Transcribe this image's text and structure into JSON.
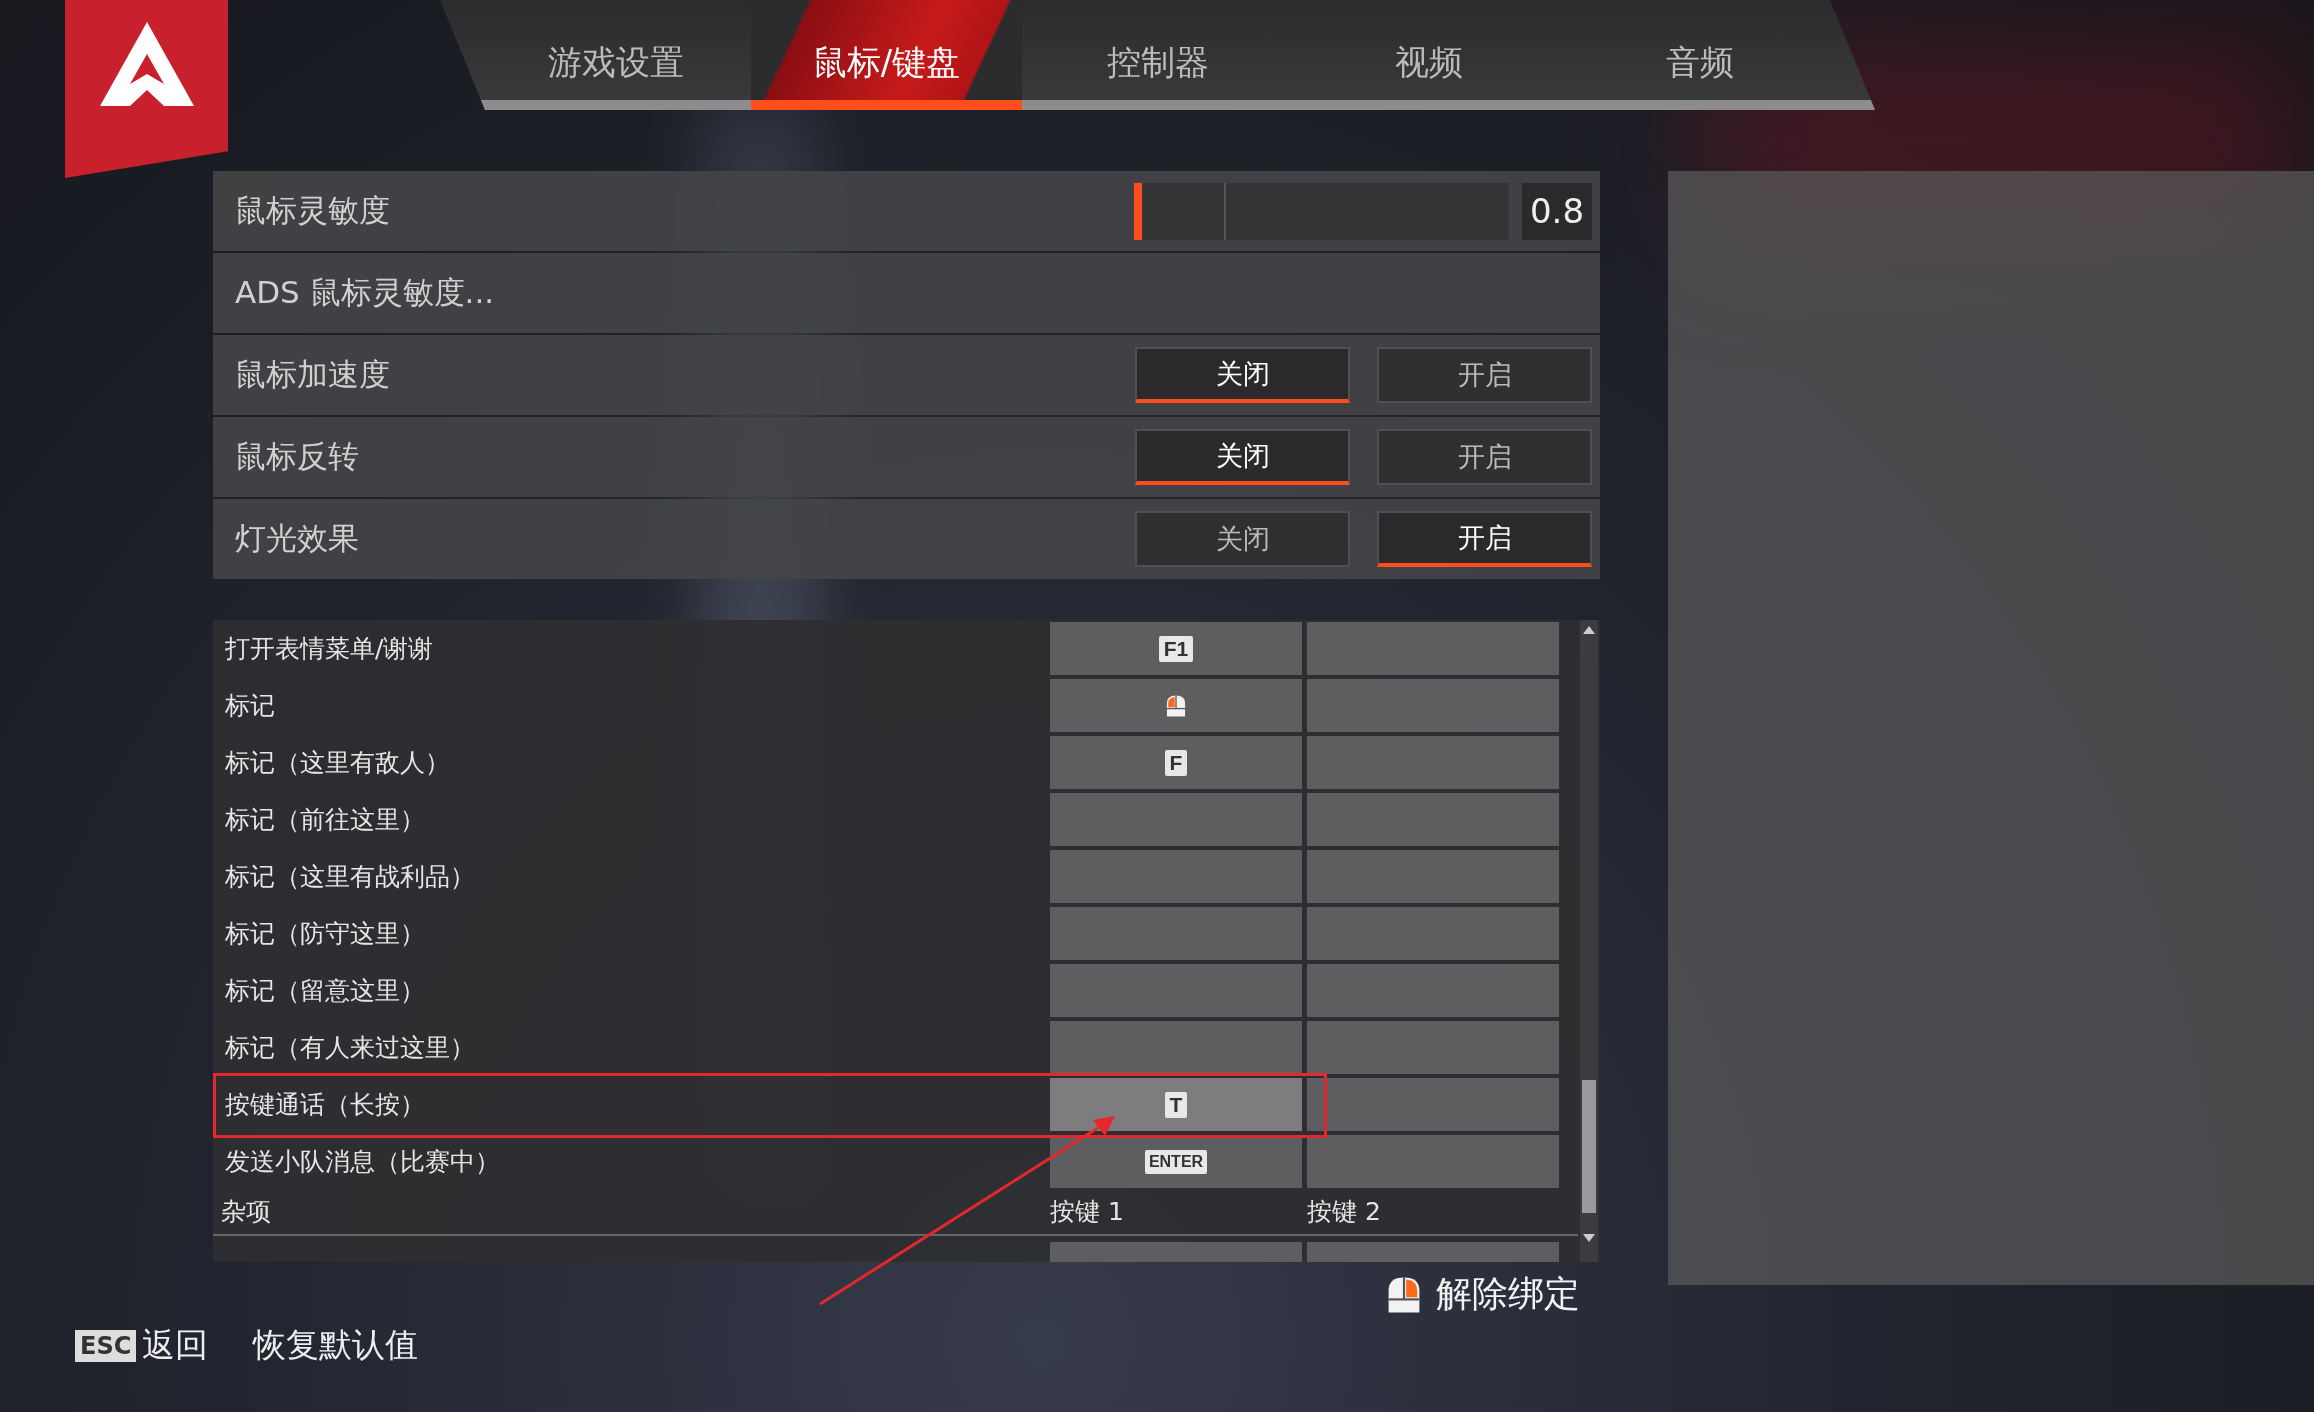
{
  "tabs": [
    {
      "label": "游戏设置",
      "selected": false
    },
    {
      "label": "鼠标/键盘",
      "selected": true
    },
    {
      "label": "控制器",
      "selected": false
    },
    {
      "label": "视频",
      "selected": false
    },
    {
      "label": "音频",
      "selected": false
    }
  ],
  "settings": [
    {
      "kind": "slider",
      "label": "鼠标灵敏度",
      "level": 0.02,
      "reading": "0.8"
    },
    {
      "kind": "link",
      "label": "ADS 鼠标灵敏度..."
    },
    {
      "kind": "toggle",
      "label": "鼠标加速度",
      "options": [
        {
          "label": "关闭",
          "selected": true
        },
        {
          "label": "开启",
          "selected": false
        }
      ]
    },
    {
      "kind": "toggle",
      "label": "鼠标反转",
      "options": [
        {
          "label": "关闭",
          "selected": true
        },
        {
          "label": "开启",
          "selected": false
        }
      ]
    },
    {
      "kind": "toggle",
      "label": "灯光效果",
      "options": [
        {
          "label": "关闭",
          "selected": false
        },
        {
          "label": "开启",
          "selected": true
        }
      ]
    }
  ],
  "bindings": [
    {
      "action": "打开表情菜单/谢谢",
      "selected": false,
      "keys": [
        {
          "kind": "key",
          "label": "F1"
        },
        {
          "kind": "empty"
        }
      ]
    },
    {
      "action": "标记",
      "selected": false,
      "keys": [
        {
          "kind": "mouse"
        },
        {
          "kind": "empty"
        }
      ]
    },
    {
      "action": "标记（这里有敌人）",
      "selected": false,
      "keys": [
        {
          "kind": "key",
          "label": "F"
        },
        {
          "kind": "empty"
        }
      ]
    },
    {
      "action": "标记（前往这里）",
      "selected": false,
      "keys": [
        {
          "kind": "empty"
        },
        {
          "kind": "empty"
        }
      ]
    },
    {
      "action": "标记（这里有战利品）",
      "selected": false,
      "keys": [
        {
          "kind": "empty"
        },
        {
          "kind": "empty"
        }
      ]
    },
    {
      "action": "标记（防守这里）",
      "selected": false,
      "keys": [
        {
          "kind": "empty"
        },
        {
          "kind": "empty"
        }
      ]
    },
    {
      "action": "标记（留意这里）",
      "selected": false,
      "keys": [
        {
          "kind": "empty"
        },
        {
          "kind": "empty"
        }
      ]
    },
    {
      "action": "标记（有人来过这里）",
      "selected": false,
      "keys": [
        {
          "kind": "empty"
        },
        {
          "kind": "empty"
        }
      ]
    },
    {
      "action": "按键通话（长按）",
      "selected": true,
      "keys": [
        {
          "kind": "key",
          "label": "T"
        },
        {
          "kind": "empty"
        }
      ]
    },
    {
      "action": "发送小队消息（比赛中）",
      "selected": false,
      "keys": [
        {
          "kind": "key",
          "label": "ENTER"
        },
        {
          "kind": "empty"
        }
      ]
    }
  ],
  "section": {
    "title": "杂项",
    "columns": [
      "按键 1",
      "按键 2"
    ]
  },
  "unbind": {
    "label": "解除绑定"
  },
  "footer": {
    "back_key": "ESC",
    "back": "返回",
    "reset": "恢复默认值"
  }
}
